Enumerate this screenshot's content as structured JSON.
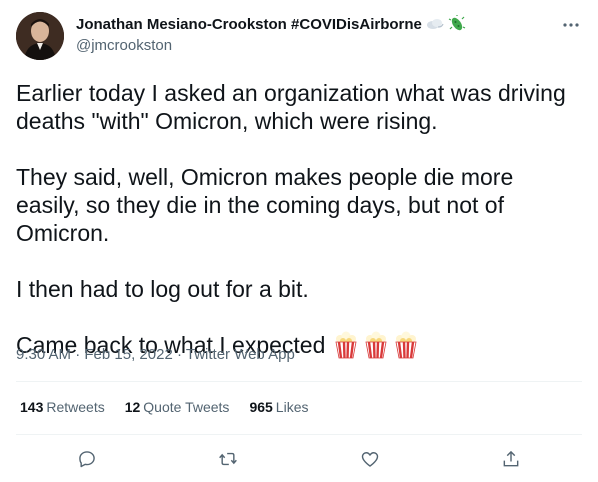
{
  "author": {
    "display_name": "Jonathan Mesiano-Crookston #COVIDisAirborne",
    "handle": "@jmcrookston",
    "name_emojis": [
      "wind-icon",
      "microbe-icon"
    ]
  },
  "tweet": {
    "paragraphs": [
      "Earlier today I asked an organization what was driving deaths \"with\" Omicron, which were rising.",
      "They said, well, Omicron makes people die more easily, so they die in the coming days, but not of Omicron.",
      "I then had to log out for a bit.",
      "Came back to what I expected"
    ],
    "trailing_emojis": [
      "popcorn-icon",
      "popcorn-icon",
      "popcorn-icon"
    ]
  },
  "meta": {
    "time": "9:30 AM",
    "separator": " · ",
    "date": "Feb 15, 2022",
    "source": "Twitter Web App"
  },
  "stats": {
    "retweets_count": "143",
    "retweets_label": "Retweets",
    "quotes_count": "12",
    "quotes_label": "Quote Tweets",
    "likes_count": "965",
    "likes_label": "Likes"
  },
  "actions": [
    "reply-icon",
    "retweet-icon",
    "like-icon",
    "share-icon"
  ],
  "colors": {
    "text": "#0f1419",
    "muted": "#536471",
    "divider": "#eff3f4",
    "microbe": "#3fa84c",
    "popcorn_red": "#d93a3a"
  }
}
